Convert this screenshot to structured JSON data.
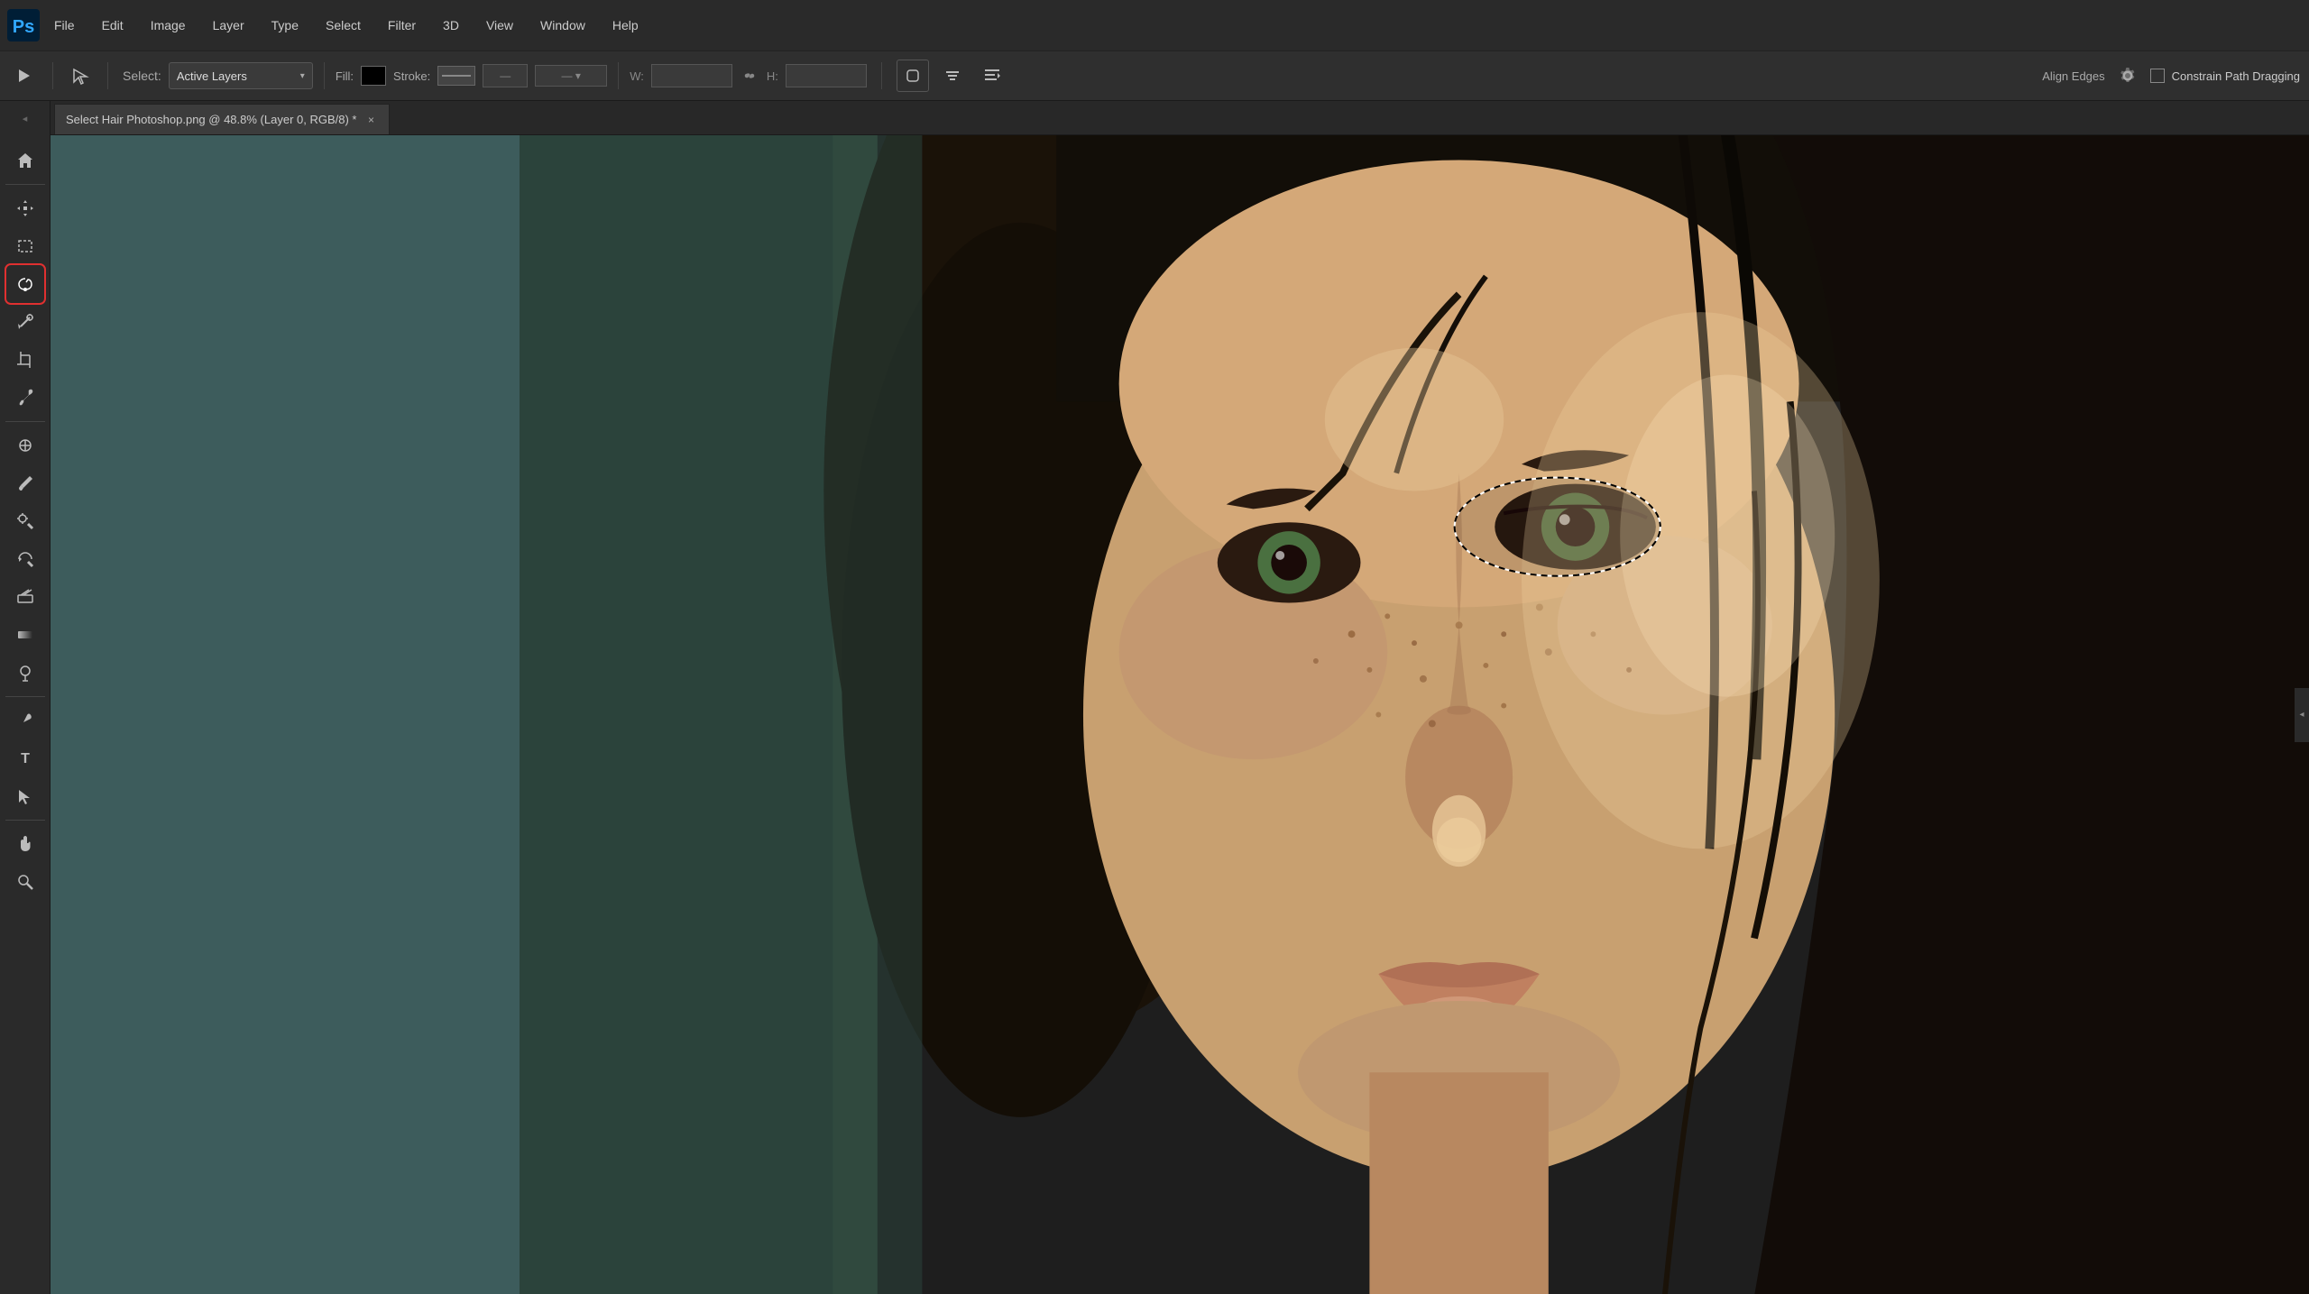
{
  "app": {
    "name": "Adobe Photoshop",
    "logo_text": "Ps"
  },
  "menu": {
    "items": [
      "File",
      "Edit",
      "Image",
      "Layer",
      "Type",
      "Select",
      "Filter",
      "3D",
      "View",
      "Window",
      "Help"
    ]
  },
  "options_bar": {
    "tool_label": "Select:",
    "select_mode": "Active Layers",
    "fill_label": "Fill:",
    "stroke_label": "Stroke:",
    "w_label": "W:",
    "h_label": "H:",
    "align_edges_label": "Align Edges",
    "constrain_label": "Constrain Path Dragging"
  },
  "tab": {
    "filename": "Select Hair Photoshop.png @ 48.8% (Layer 0, RGB/8) *",
    "close": "×"
  },
  "tools": [
    {
      "name": "move",
      "icon": "✛",
      "label": "Move Tool"
    },
    {
      "name": "marquee",
      "icon": "⬚",
      "label": "Marquee Tool"
    },
    {
      "name": "lasso",
      "icon": "⊙",
      "label": "Lasso Tool",
      "active": true,
      "selected": true
    },
    {
      "name": "magic-wand",
      "icon": "⤢",
      "label": "Magic Wand Tool"
    },
    {
      "name": "crop",
      "icon": "⊡",
      "label": "Crop Tool"
    },
    {
      "name": "eyedropper",
      "icon": "⌀",
      "label": "Eyedropper Tool"
    },
    {
      "name": "separator1"
    },
    {
      "name": "healing",
      "icon": "✜",
      "label": "Healing Brush"
    },
    {
      "name": "brush",
      "icon": "✏",
      "label": "Brush Tool"
    },
    {
      "name": "clone",
      "icon": "⎘",
      "label": "Clone Stamp"
    },
    {
      "name": "history-brush",
      "icon": "↩",
      "label": "History Brush"
    },
    {
      "name": "eraser",
      "icon": "⬜",
      "label": "Eraser Tool"
    },
    {
      "name": "gradient",
      "icon": "◐",
      "label": "Gradient Tool"
    },
    {
      "name": "dodge",
      "icon": "◌",
      "label": "Dodge Tool"
    },
    {
      "name": "separator2"
    },
    {
      "name": "pen",
      "icon": "✒",
      "label": "Pen Tool"
    },
    {
      "name": "text",
      "icon": "T",
      "label": "Text Tool"
    },
    {
      "name": "path-select",
      "icon": "↖",
      "label": "Path Selection Tool"
    },
    {
      "name": "separator3"
    },
    {
      "name": "hand",
      "icon": "☚",
      "label": "Hand Tool"
    }
  ]
}
